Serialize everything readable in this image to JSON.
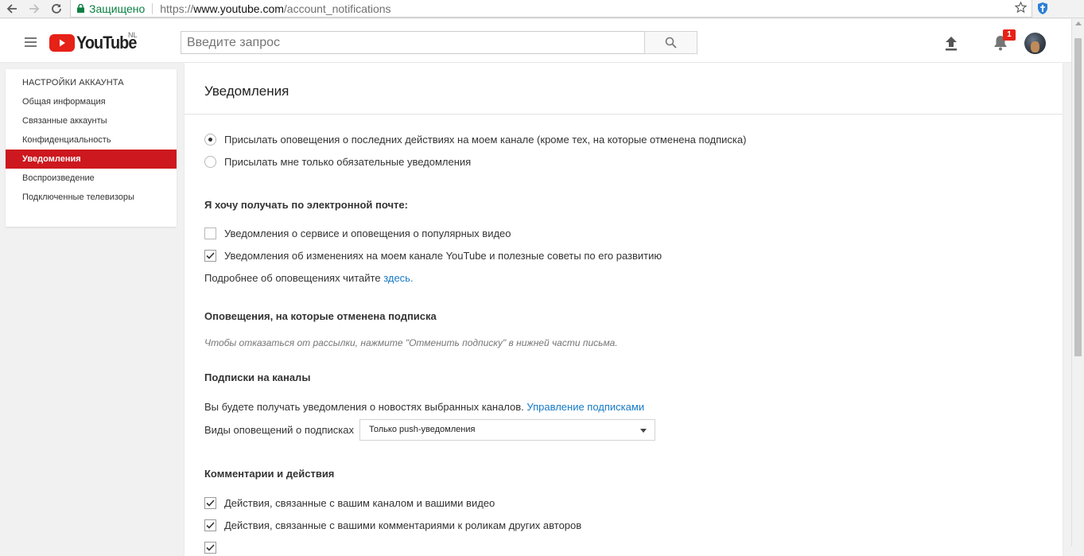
{
  "browser": {
    "secure_label": "Защищено",
    "url_scheme": "https://",
    "url_host": "www.youtube.com",
    "url_path": "/account_notifications"
  },
  "masthead": {
    "logo_text": "YouTube",
    "region": "NL",
    "search_placeholder": "Введите запрос",
    "notification_count": "1"
  },
  "sidebar": {
    "heading": "НАСТРОЙКИ АККАУНТА",
    "items": [
      {
        "label": "Общая информация"
      },
      {
        "label": "Связанные аккаунты"
      },
      {
        "label": "Конфиденциальность"
      },
      {
        "label": "Уведомления"
      },
      {
        "label": "Воспроизведение"
      },
      {
        "label": "Подключенные телевизоры"
      }
    ]
  },
  "main": {
    "title": "Уведомления",
    "radio_options": [
      {
        "label": "Присылать оповещения о последних действиях на моем канале (кроме тех, на которые отменена подписка)",
        "selected": true
      },
      {
        "label": "Присылать мне только обязательные уведомления",
        "selected": false
      }
    ],
    "email_section": {
      "title": "Я хочу получать по электронной почте:",
      "options": [
        {
          "label": "Уведомления о сервисе и оповещения о популярных видео",
          "checked": false
        },
        {
          "label": "Уведомления об изменениях на моем канале YouTube и полезные советы по его развитию",
          "checked": true
        }
      ],
      "more_info": "Подробнее об оповещениях читайте",
      "more_info_link": "здесь."
    },
    "unsubscribed_section": {
      "title": "Оповещения, на которые отменена подписка",
      "hint": "Чтобы отказаться от рассылки, нажмите \"Отменить подписку\" в нижней части письма."
    },
    "subscriptions_section": {
      "title": "Подписки на каналы",
      "description": "Вы будете получать уведомления о новостях выбранных каналов.",
      "manage_link": "Управление подписками",
      "select_label": "Виды оповещений о подписках",
      "select_value": "Только push-уведомления"
    },
    "comments_section": {
      "title": "Комментарии и действия",
      "options": [
        {
          "label": "Действия, связанные с вашим каналом и вашими видео",
          "checked": true
        },
        {
          "label": "Действия, связанные с вашими комментариями к роликам других авторов",
          "checked": true
        }
      ]
    }
  },
  "colors": {
    "brand_red": "#e62117",
    "active_nav": "#cc181e",
    "link_blue": "#167ac6",
    "secure_green": "#0b8043"
  }
}
